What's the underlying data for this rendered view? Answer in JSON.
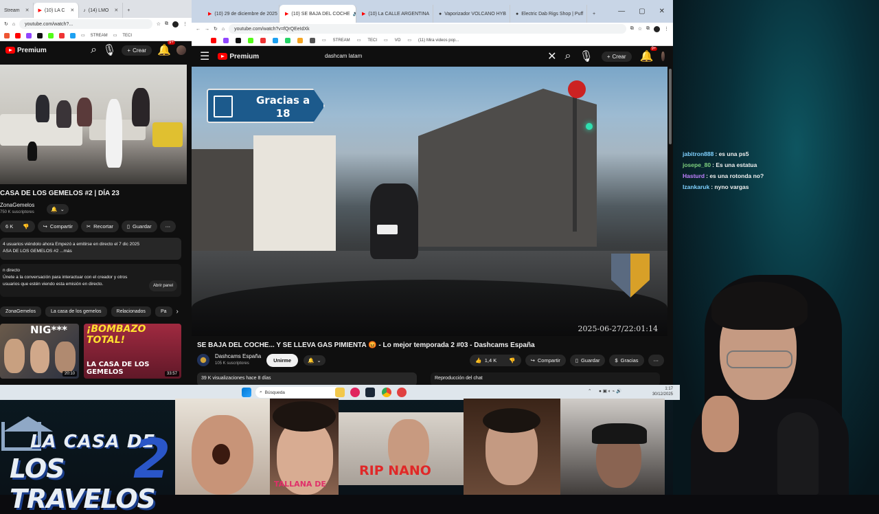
{
  "left_browser": {
    "tabs": [
      {
        "label": "Stream"
      },
      {
        "label": "(10) LA C"
      },
      {
        "label": "(14) LMO"
      }
    ],
    "url": "youtube.com/watch?...",
    "bookmarks": [
      "STREAM",
      "TECI"
    ],
    "youtube": {
      "logo": "Premium",
      "create_label": "Crear",
      "notif_count": "9+",
      "video_title": "CASA DE LOS GEMELOS #2 | DÍA 23",
      "channel_name": "ZonaGemelos",
      "subscribers": "750 K suscriptores",
      "likes": "6 K",
      "share_label": "Compartir",
      "clip_label": "Recortar",
      "save_label": "Guardar",
      "desc_line1": "4 usuarios viéndolo ahora  Empezó a emitirse en directo el 7 dic 2025",
      "desc_line2": "ASA DE LOS GEMELOS #2 ...más",
      "live_chat_title": "n directo",
      "live_chat_text1": "Únete a la conversación para interactuar con el creador y otros",
      "live_chat_text2": "usuarios que estén viendo esta emisión en directo.",
      "open_panel_label": "Abrir panel",
      "chips": [
        "ZonaGemelos",
        "La casa de los gemelos",
        "Relacionados",
        "Pa"
      ],
      "rec1_title": "NIG***",
      "rec1_duration": "20:10",
      "rec2_title": "¡BOMBAZO TOTAL!",
      "rec2_caption": "LA CASA DE LOS GEMELOS",
      "rec2_duration": "33:57"
    }
  },
  "right_browser": {
    "tabs": [
      {
        "label": "(10) 29 de diciembre de 2025"
      },
      {
        "label": "(10) SE BAJA DEL COCHE"
      },
      {
        "label": "(10) La CALLE ARGENTINA"
      },
      {
        "label": "Vaporizador VOLCANO HYB"
      },
      {
        "label": "Electric Dab Rigs Shop | Puff"
      }
    ],
    "url": "youtube.com/watch?v=fQrQEeIdXk",
    "bookmarks": [
      "STREAM",
      "TECI",
      "VO",
      "(11) Mira videos pop..."
    ],
    "youtube": {
      "logo": "Premium",
      "search_value": "dashcam latam",
      "create_label": "Crear",
      "notif_count": "9+",
      "sign_text_line1": "Gracias a",
      "sign_text_line2": "18",
      "timestamp": "2025-06-27/22:01:14",
      "video_title": "SE BAJA DEL COCHE... Y SE LLEVA GAS PIMIENTA 😡 - Lo mejor temporada 2 #03 - Dashcams España",
      "channel_name": "Dashcams España",
      "subscribers": "105 K suscriptores",
      "subscribe_label": "Unirme",
      "likes": "1,4 K",
      "share_label": "Compartir",
      "save_label": "Guardar",
      "thanks_label": "Gracias",
      "views": "39 K visualizaciones  hace 8 días",
      "chat_replay": "Reproducción del chat"
    }
  },
  "taskbar": {
    "search_placeholder": "Búsqueda",
    "time": "1:17",
    "date": "30/12/2025"
  },
  "chat": [
    {
      "user": "jabitron888",
      "color": "#7fd1ff",
      "msg": "es una ps5"
    },
    {
      "user": "josepe_80",
      "color": "#7fd17f",
      "msg": "Es una estatua"
    },
    {
      "user": "Hasturd",
      "color": "#c080ff",
      "msg": "es una rotonda no?"
    },
    {
      "user": "Izankaruk",
      "color": "#7fd1ff",
      "msg": "nyno vargas"
    }
  ],
  "overlay": {
    "logo_line1": "LA CASA DE",
    "logo_line2": "LOS TRAVELOS",
    "logo_number": "2",
    "caption_tallana": "TALLANA DE",
    "caption_rip": "RIP NANO"
  }
}
